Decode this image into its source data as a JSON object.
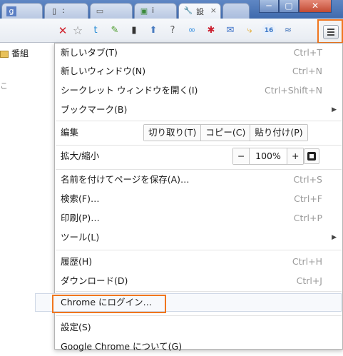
{
  "tabs": [
    {
      "favicon": "g-icon",
      "glyph": "g",
      "title": ""
    },
    {
      "favicon": "phone-icon",
      "glyph": "▯",
      "title": ":"
    },
    {
      "favicon": "page-icon",
      "glyph": "▭",
      "title": ""
    },
    {
      "favicon": "image-icon",
      "glyph": "▣",
      "title": "i"
    },
    {
      "favicon": "wrench-icon",
      "glyph": "🔧",
      "title": "設"
    }
  ],
  "window_controls": {
    "minimize": "─",
    "maximize": "▢",
    "close": "✕"
  },
  "toolbar": {
    "stop": "✕",
    "star": "☆",
    "extensions": [
      {
        "name": "twitter-extension-icon",
        "glyph": "t",
        "color": "#2b8fd6"
      },
      {
        "name": "evernote-extension-icon",
        "glyph": "✎",
        "color": "#4a9a2a"
      },
      {
        "name": "mobile-extension-icon",
        "glyph": "▮",
        "color": "#333333"
      },
      {
        "name": "upload-extension-icon",
        "glyph": "⬆",
        "color": "#4a7cc0"
      },
      {
        "name": "help-extension-icon",
        "glyph": "?",
        "color": "#555555"
      },
      {
        "name": "link-extension-icon",
        "glyph": "∞",
        "color": "#2c8be0"
      },
      {
        "name": "star-extension-icon",
        "glyph": "✱",
        "color": "#cc1f2f"
      },
      {
        "name": "feedback-extension-icon",
        "glyph": "✉",
        "color": "#3a6fc7"
      },
      {
        "name": "device-extension-icon",
        "glyph": "⤷",
        "color": "#e3a21a"
      },
      {
        "name": "badge-extension-icon",
        "glyph": "16",
        "color": "#3a78c8"
      },
      {
        "name": "chart-extension-icon",
        "glyph": "≈",
        "color": "#2a62b0"
      }
    ],
    "menu_icon": "menu-icon"
  },
  "page": {
    "bookmark_folder": "番組",
    "hint": "こ"
  },
  "menu": {
    "new_tab": {
      "label": "新しいタブ(T)",
      "shortcut": "Ctrl+T"
    },
    "new_window": {
      "label": "新しいウィンドウ(N)",
      "shortcut": "Ctrl+N"
    },
    "incognito": {
      "label": "シークレット ウィンドウを開く(I)",
      "shortcut": "Ctrl+Shift+N"
    },
    "bookmarks": {
      "label": "ブックマーク(B)",
      "arrow": "▶"
    },
    "edit": {
      "label": "編集",
      "cut": "切り取り(T)",
      "copy": "コピー(C)",
      "paste": "貼り付け(P)"
    },
    "zoom": {
      "label": "拡大/縮小",
      "minus": "−",
      "value": "100%",
      "plus": "+"
    },
    "save_page": {
      "label": "名前を付けてページを保存(A)…",
      "shortcut": "Ctrl+S"
    },
    "find": {
      "label": "検索(F)…",
      "shortcut": "Ctrl+F"
    },
    "print": {
      "label": "印刷(P)…",
      "shortcut": "Ctrl+P"
    },
    "tools": {
      "label": "ツール(L)",
      "arrow": "▶"
    },
    "history": {
      "label": "履歴(H)",
      "shortcut": "Ctrl+H"
    },
    "downloads": {
      "label": "ダウンロード(D)",
      "shortcut": "Ctrl+J"
    },
    "signin": {
      "label": "Chrome にログイン…"
    },
    "settings": {
      "label": "設定(S)"
    },
    "about": {
      "label": "Google Chrome について(G)"
    }
  },
  "highlight_color": "#f0761e"
}
